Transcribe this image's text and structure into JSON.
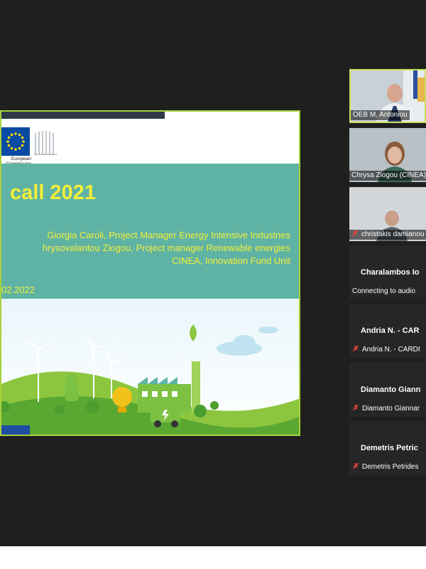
{
  "slide": {
    "logo_text_line1": "European",
    "logo_text_line2": "Commission",
    "title": "call 2021",
    "presenter_line1": "Giorgia Caroli, Project Manager Energy Intensive Industries",
    "presenter_line2": "hrysovalantou Ziogou, Project manager Renewable energies",
    "presenter_line3": "CINEA, Innovation Fund Unit",
    "date": "02.2022"
  },
  "participants": [
    {
      "name": "OEB M. Antoniou",
      "type": "video",
      "active": true
    },
    {
      "name": "Chrysa Ziogou (CINEA)",
      "type": "video"
    },
    {
      "name": "christakis damianou",
      "type": "video",
      "muted": true
    },
    {
      "display_name": "Charalambos Io",
      "status": "Connecting to audio"
    },
    {
      "display_name": "Andria N. - CAR",
      "footer": "Andria N. - CARDI",
      "muted": true
    },
    {
      "display_name": "Diamanto Giann",
      "footer": "Diamanto Giannar",
      "muted": true
    },
    {
      "display_name": "Demetris Petric",
      "footer": "Demetris Petrides",
      "muted": true
    }
  ],
  "colors": {
    "active_border": "#c8e05a",
    "slide_border": "#a6d13c",
    "teal": "#5fb3a4",
    "title_yellow": "#f4ef3a"
  }
}
